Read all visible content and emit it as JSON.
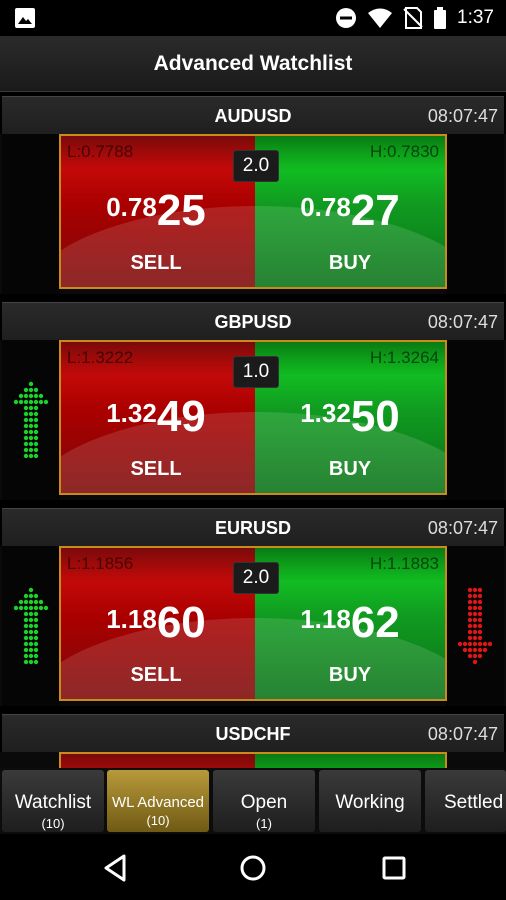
{
  "status_bar": {
    "time": "1:37",
    "icons": [
      "image-icon",
      "dnd-icon",
      "wifi-icon",
      "no-sim-icon",
      "battery-icon"
    ]
  },
  "header": {
    "title": "Advanced Watchlist"
  },
  "colors": {
    "sell": "#c40f0f",
    "buy": "#12a820",
    "border": "#c98b1c",
    "tab_active": "#a88a2a",
    "up_arrow": "#1bd12b",
    "down_arrow": "#e01515"
  },
  "watchlist": [
    {
      "symbol": "AUDUSD",
      "time": "08:07:47",
      "low": "L:0.7788",
      "high": "H:0.7830",
      "spread": "2.0",
      "sell": {
        "small": "0.78",
        "big": "25",
        "label": "SELL"
      },
      "buy": {
        "small": "0.78",
        "big": "27",
        "label": "BUY"
      },
      "left_arrow": "none",
      "right_arrow": "none"
    },
    {
      "symbol": "GBPUSD",
      "time": "08:07:47",
      "low": "L:1.3222",
      "high": "H:1.3264",
      "spread": "1.0",
      "sell": {
        "small": "1.32",
        "big": "49",
        "label": "SELL"
      },
      "buy": {
        "small": "1.32",
        "big": "50",
        "label": "BUY"
      },
      "left_arrow": "up",
      "right_arrow": "none"
    },
    {
      "symbol": "EURUSD",
      "time": "08:07:47",
      "low": "L:1.1856",
      "high": "H:1.1883",
      "spread": "2.0",
      "sell": {
        "small": "1.18",
        "big": "60",
        "label": "SELL"
      },
      "buy": {
        "small": "1.18",
        "big": "62",
        "label": "BUY"
      },
      "left_arrow": "up",
      "right_arrow": "down"
    },
    {
      "symbol": "USDCHF",
      "time": "08:07:47"
    }
  ],
  "tabs": [
    {
      "label": "Watchlist",
      "count": "(10)"
    },
    {
      "label": "WL Advanced",
      "count": "(10)",
      "active": true
    },
    {
      "label": "Open",
      "count": "(1)"
    },
    {
      "label": "Working",
      "count": ""
    },
    {
      "label": "Settled",
      "count": ""
    }
  ],
  "nav": [
    "back-icon",
    "home-icon",
    "recents-icon"
  ]
}
